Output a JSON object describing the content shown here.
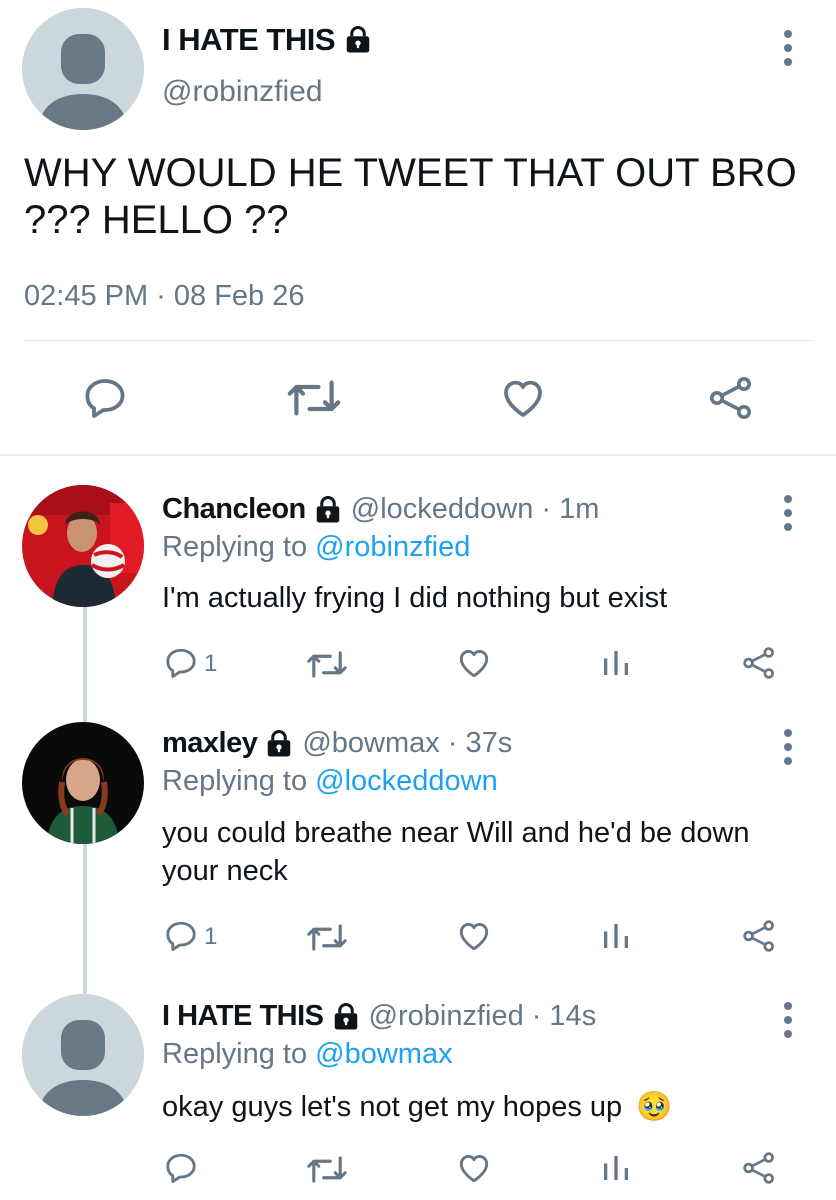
{
  "main_tweet": {
    "display_name": "I HATE THIS",
    "handle": "@robinzfied",
    "text": "WHY WOULD HE TWEET THAT OUT BRO ??? HELLO ??",
    "timestamp": "02:45 PM · 08 Feb 26",
    "icons": [
      "reply-icon",
      "retweet-icon",
      "like-icon",
      "share-icon",
      "more-icon",
      "lock-icon"
    ]
  },
  "replies": [
    {
      "display_name": "Chancleon",
      "handle": "@lockeddown",
      "time": "· 1m",
      "replying_prefix": "Replying to",
      "replying_to": "@robinzfied",
      "text": "I'm actually frying I did nothing but exist",
      "reply_count": "1"
    },
    {
      "display_name": "maxley",
      "handle": "@bowmax",
      "time": "· 37s",
      "replying_prefix": "Replying to",
      "replying_to": "@lockeddown",
      "text": "you could breathe near Will and he'd be down your neck",
      "reply_count": "1"
    },
    {
      "display_name": "I HATE THIS",
      "handle": "@robinzfied",
      "time": "· 14s",
      "replying_prefix": "Replying to",
      "replying_to": "@bowmax",
      "text": "okay guys let's not get my hopes up",
      "emoji": "🥹",
      "reply_count": ""
    }
  ],
  "colors": {
    "accent": "#1da1f2",
    "text": "#0f1419",
    "muted": "#657786",
    "divider": "#e1e8ed",
    "avatar_bg": "#ccd6dd",
    "avatar_fg": "#697887"
  }
}
